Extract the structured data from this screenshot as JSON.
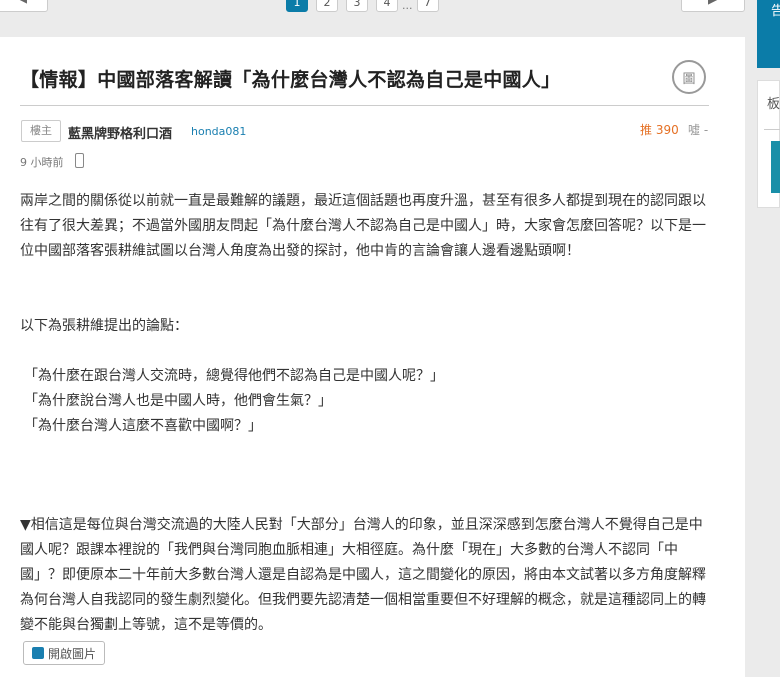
{
  "nav": {
    "back_arrow": "◀",
    "pages": [
      "1",
      "2",
      "3",
      "4"
    ],
    "ellipsis": "...",
    "last_page": "7",
    "next_arrow": "▶"
  },
  "post": {
    "title": "【情報】中國部落客解讀「為什麼台灣人不認為自己是中國人」",
    "title_button_icon": "圖",
    "author_badge": "樓主",
    "author_name": "藍黑牌野格利口酒",
    "author_id": "honda081",
    "push": "推 390",
    "boo": "噓 -",
    "time": "9 小時前",
    "p1": "兩岸之間的關係從以前就一直是最難解的議題，最近這個話題也再度升溫，甚至有很多人都提到現在的認同跟以往有了很大差異；不過當外國朋友問起「為什麼台灣人不認為自己是中國人」時，大家會怎麼回答呢？以下是一位中國部落客張耕維試圖以台灣人角度為出發的探討，他中肯的言論會讓人邊看邊點頭啊！",
    "p2": "以下為張耕維提出的論點：",
    "quotes": [
      "「為什麼在跟台灣人交流時，總覺得他們不認為自己是中國人呢？」",
      "「為什麼說台灣人也是中國人時，他們會生氣？」",
      "「為什麼台灣人這麼不喜歡中國啊？」"
    ],
    "p3": "▼相信這是每位與台灣交流過的大陸人民對「大部分」台灣人的印象，並且深深感到怎麼台灣人不覺得自己是中國人呢？跟課本裡說的「我們與台灣同胞血脈相連」大相徑庭。為什麼「現在」大多數的台灣人不認同「中國」？即便原本二十年前大多數台灣人還是自認為是中國人，這之間變化的原因，將由本文試著以多方角度解釋為何台灣人自我認同的發生劇烈變化。但我們要先認清楚一個相當重要但不好理解的概念，就是這種認同上的轉變不能與台獨劃上等號，這不是等價的。",
    "open_images_label": "開啟圖片"
  },
  "sidebar": {
    "top_label": "告",
    "panel_label": "板"
  },
  "colors": {
    "accent": "#0b7ca8",
    "push": "#e57024",
    "link": "#1a7fb0"
  }
}
